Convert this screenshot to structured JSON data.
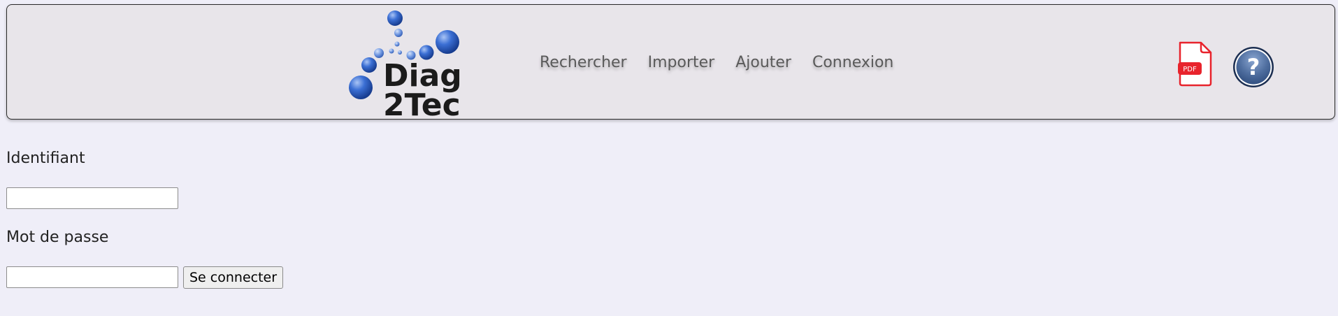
{
  "header": {
    "logo": {
      "text_top": "Diag",
      "text_bottom": "2Tec",
      "icon": "diag2tec-bubbles-logo"
    },
    "nav": [
      {
        "label": "Rechercher"
      },
      {
        "label": "Importer"
      },
      {
        "label": "Ajouter"
      },
      {
        "label": "Connexion"
      }
    ],
    "pdf_icon": {
      "icon": "pdf-file-icon",
      "text": "PDF",
      "color": "#e8232c"
    },
    "help_icon": {
      "icon": "help-icon",
      "text": "?",
      "color": "#4f6e9f"
    }
  },
  "login_form": {
    "username_label": "Identifiant",
    "username_value": "",
    "password_label": "Mot de passe",
    "password_value": "",
    "submit_label": "Se connecter"
  },
  "colors": {
    "page_background": "#efeef8",
    "header_background": "#e8e5ea",
    "logo_blue": "#2f5fbf"
  }
}
